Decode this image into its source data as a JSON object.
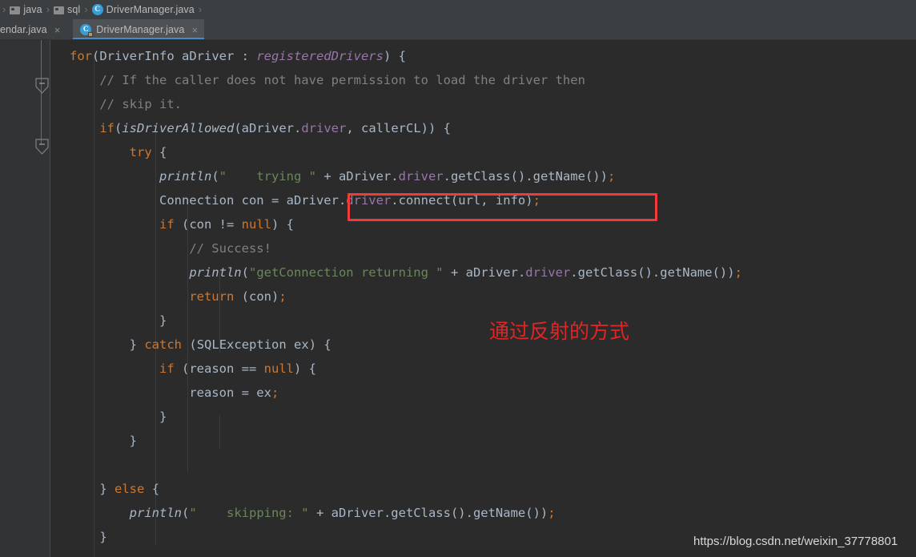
{
  "breadcrumb": {
    "items": [
      {
        "icon": "folder-icon",
        "label": "java"
      },
      {
        "icon": "folder-icon",
        "label": "sql"
      },
      {
        "icon": "java-class-icon",
        "label": "DriverManager.java"
      }
    ],
    "separator": "›",
    "class_glyph": "C"
  },
  "tabs": [
    {
      "label": "endar.java",
      "close": "×",
      "active": false,
      "icon": ""
    },
    {
      "label": "DriverManager.java",
      "close": "×",
      "active": true,
      "icon": "java-class-locked-icon",
      "glyph": "C"
    }
  ],
  "gutter": {
    "markers": [
      {
        "name": "implementing-method-marker"
      },
      {
        "name": "overriding-method-marker"
      }
    ]
  },
  "code": {
    "language": "java",
    "lines": [
      "for(DriverInfo aDriver : registeredDrivers) {",
      "    // If the caller does not have permission to load the driver then",
      "    // skip it.",
      "    if(isDriverAllowed(aDriver.driver, callerCL)) {",
      "        try {",
      "            println(\"    trying \" + aDriver.driver.getClass().getName());",
      "            Connection con = aDriver.driver.connect(url, info);",
      "            if (con != null) {",
      "                // Success!",
      "                println(\"getConnection returning \" + aDriver.driver.getClass().getName());",
      "                return (con);",
      "            }",
      "        } catch (SQLException ex) {",
      "            if (reason == null) {",
      "                reason = ex;",
      "            }",
      "        }",
      "",
      "    } else {",
      "        println(\"    skipping: \" + aDriver.getClass().getName());",
      "    }"
    ]
  },
  "annotations": {
    "chinese_note": "通过反射的方式",
    "highlight_target": "aDriver.driver.connect(url, info);"
  },
  "watermark": {
    "text": "https://blog.csdn.net/weixin_37778801"
  },
  "colors": {
    "background": "#2b2b2b",
    "gutter": "#313335",
    "chrome": "#3c3f41",
    "tab_active": "#4e5254",
    "tab_underline": "#4a88c7",
    "keyword": "#cc7832",
    "string": "#6a8759",
    "field": "#9876aa",
    "comment": "#808080",
    "text": "#a9b7c6",
    "highlight_red": "#f23a3a",
    "annotation_red": "#e02525"
  }
}
